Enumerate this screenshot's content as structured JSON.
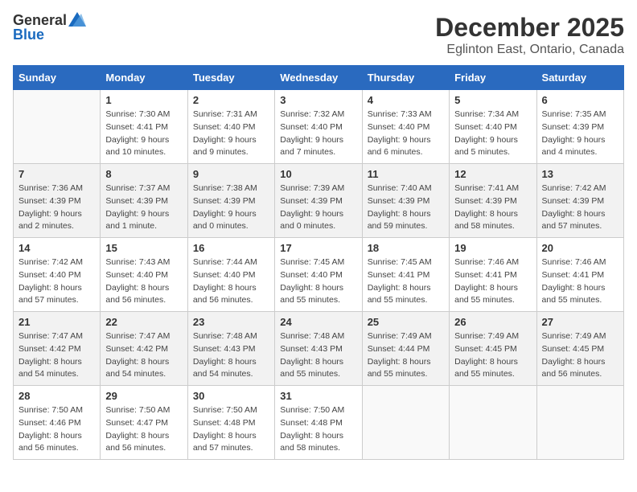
{
  "logo": {
    "general": "General",
    "blue": "Blue"
  },
  "title": "December 2025",
  "subtitle": "Eglinton East, Ontario, Canada",
  "days_header": [
    "Sunday",
    "Monday",
    "Tuesday",
    "Wednesday",
    "Thursday",
    "Friday",
    "Saturday"
  ],
  "weeks": [
    [
      {
        "num": "",
        "sunrise": "",
        "sunset": "",
        "daylight": ""
      },
      {
        "num": "1",
        "sunrise": "Sunrise: 7:30 AM",
        "sunset": "Sunset: 4:41 PM",
        "daylight": "Daylight: 9 hours and 10 minutes."
      },
      {
        "num": "2",
        "sunrise": "Sunrise: 7:31 AM",
        "sunset": "Sunset: 4:40 PM",
        "daylight": "Daylight: 9 hours and 9 minutes."
      },
      {
        "num": "3",
        "sunrise": "Sunrise: 7:32 AM",
        "sunset": "Sunset: 4:40 PM",
        "daylight": "Daylight: 9 hours and 7 minutes."
      },
      {
        "num": "4",
        "sunrise": "Sunrise: 7:33 AM",
        "sunset": "Sunset: 4:40 PM",
        "daylight": "Daylight: 9 hours and 6 minutes."
      },
      {
        "num": "5",
        "sunrise": "Sunrise: 7:34 AM",
        "sunset": "Sunset: 4:40 PM",
        "daylight": "Daylight: 9 hours and 5 minutes."
      },
      {
        "num": "6",
        "sunrise": "Sunrise: 7:35 AM",
        "sunset": "Sunset: 4:39 PM",
        "daylight": "Daylight: 9 hours and 4 minutes."
      }
    ],
    [
      {
        "num": "7",
        "sunrise": "Sunrise: 7:36 AM",
        "sunset": "Sunset: 4:39 PM",
        "daylight": "Daylight: 9 hours and 2 minutes."
      },
      {
        "num": "8",
        "sunrise": "Sunrise: 7:37 AM",
        "sunset": "Sunset: 4:39 PM",
        "daylight": "Daylight: 9 hours and 1 minute."
      },
      {
        "num": "9",
        "sunrise": "Sunrise: 7:38 AM",
        "sunset": "Sunset: 4:39 PM",
        "daylight": "Daylight: 9 hours and 0 minutes."
      },
      {
        "num": "10",
        "sunrise": "Sunrise: 7:39 AM",
        "sunset": "Sunset: 4:39 PM",
        "daylight": "Daylight: 9 hours and 0 minutes."
      },
      {
        "num": "11",
        "sunrise": "Sunrise: 7:40 AM",
        "sunset": "Sunset: 4:39 PM",
        "daylight": "Daylight: 8 hours and 59 minutes."
      },
      {
        "num": "12",
        "sunrise": "Sunrise: 7:41 AM",
        "sunset": "Sunset: 4:39 PM",
        "daylight": "Daylight: 8 hours and 58 minutes."
      },
      {
        "num": "13",
        "sunrise": "Sunrise: 7:42 AM",
        "sunset": "Sunset: 4:39 PM",
        "daylight": "Daylight: 8 hours and 57 minutes."
      }
    ],
    [
      {
        "num": "14",
        "sunrise": "Sunrise: 7:42 AM",
        "sunset": "Sunset: 4:40 PM",
        "daylight": "Daylight: 8 hours and 57 minutes."
      },
      {
        "num": "15",
        "sunrise": "Sunrise: 7:43 AM",
        "sunset": "Sunset: 4:40 PM",
        "daylight": "Daylight: 8 hours and 56 minutes."
      },
      {
        "num": "16",
        "sunrise": "Sunrise: 7:44 AM",
        "sunset": "Sunset: 4:40 PM",
        "daylight": "Daylight: 8 hours and 56 minutes."
      },
      {
        "num": "17",
        "sunrise": "Sunrise: 7:45 AM",
        "sunset": "Sunset: 4:40 PM",
        "daylight": "Daylight: 8 hours and 55 minutes."
      },
      {
        "num": "18",
        "sunrise": "Sunrise: 7:45 AM",
        "sunset": "Sunset: 4:41 PM",
        "daylight": "Daylight: 8 hours and 55 minutes."
      },
      {
        "num": "19",
        "sunrise": "Sunrise: 7:46 AM",
        "sunset": "Sunset: 4:41 PM",
        "daylight": "Daylight: 8 hours and 55 minutes."
      },
      {
        "num": "20",
        "sunrise": "Sunrise: 7:46 AM",
        "sunset": "Sunset: 4:41 PM",
        "daylight": "Daylight: 8 hours and 55 minutes."
      }
    ],
    [
      {
        "num": "21",
        "sunrise": "Sunrise: 7:47 AM",
        "sunset": "Sunset: 4:42 PM",
        "daylight": "Daylight: 8 hours and 54 minutes."
      },
      {
        "num": "22",
        "sunrise": "Sunrise: 7:47 AM",
        "sunset": "Sunset: 4:42 PM",
        "daylight": "Daylight: 8 hours and 54 minutes."
      },
      {
        "num": "23",
        "sunrise": "Sunrise: 7:48 AM",
        "sunset": "Sunset: 4:43 PM",
        "daylight": "Daylight: 8 hours and 54 minutes."
      },
      {
        "num": "24",
        "sunrise": "Sunrise: 7:48 AM",
        "sunset": "Sunset: 4:43 PM",
        "daylight": "Daylight: 8 hours and 55 minutes."
      },
      {
        "num": "25",
        "sunrise": "Sunrise: 7:49 AM",
        "sunset": "Sunset: 4:44 PM",
        "daylight": "Daylight: 8 hours and 55 minutes."
      },
      {
        "num": "26",
        "sunrise": "Sunrise: 7:49 AM",
        "sunset": "Sunset: 4:45 PM",
        "daylight": "Daylight: 8 hours and 55 minutes."
      },
      {
        "num": "27",
        "sunrise": "Sunrise: 7:49 AM",
        "sunset": "Sunset: 4:45 PM",
        "daylight": "Daylight: 8 hours and 56 minutes."
      }
    ],
    [
      {
        "num": "28",
        "sunrise": "Sunrise: 7:50 AM",
        "sunset": "Sunset: 4:46 PM",
        "daylight": "Daylight: 8 hours and 56 minutes."
      },
      {
        "num": "29",
        "sunrise": "Sunrise: 7:50 AM",
        "sunset": "Sunset: 4:47 PM",
        "daylight": "Daylight: 8 hours and 56 minutes."
      },
      {
        "num": "30",
        "sunrise": "Sunrise: 7:50 AM",
        "sunset": "Sunset: 4:48 PM",
        "daylight": "Daylight: 8 hours and 57 minutes."
      },
      {
        "num": "31",
        "sunrise": "Sunrise: 7:50 AM",
        "sunset": "Sunset: 4:48 PM",
        "daylight": "Daylight: 8 hours and 58 minutes."
      },
      {
        "num": "",
        "sunrise": "",
        "sunset": "",
        "daylight": ""
      },
      {
        "num": "",
        "sunrise": "",
        "sunset": "",
        "daylight": ""
      },
      {
        "num": "",
        "sunrise": "",
        "sunset": "",
        "daylight": ""
      }
    ]
  ]
}
